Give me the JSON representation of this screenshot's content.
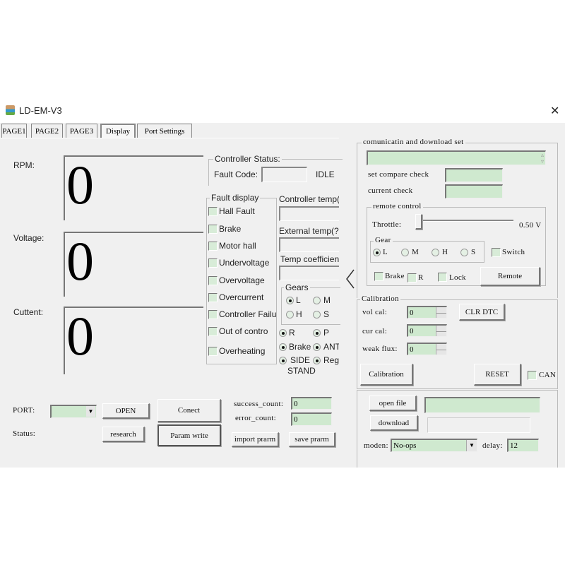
{
  "window": {
    "title": "LD-EM-V3",
    "close": "✕"
  },
  "tabs": [
    "PAGE1",
    "PAGE2",
    "PAGE3",
    "Display",
    "Port Settings"
  ],
  "display": {
    "rpm_label": "RPM:",
    "rpm": "0",
    "voltage_label": "Voltage:",
    "voltage": "0",
    "current_label": "Cuttent:",
    "current": "0"
  },
  "controller_status": {
    "title": "Controller Status:",
    "fault_code_label": "Fault Code:",
    "state": "IDLE"
  },
  "fault_display": {
    "title": "Fault display",
    "items": [
      "Hall Fault",
      "Brake",
      "Motor hall",
      "Undervoltage",
      "Overvoltage",
      "Overcurrent",
      "Controller Failure",
      "Out of contro",
      "Overheating"
    ]
  },
  "temps": {
    "controller": "Controller temp(?",
    "external": "External temp(?)",
    "coefficient": "Temp coefficient"
  },
  "gears": {
    "title": "Gears",
    "options": [
      "L",
      "M",
      "H",
      "S"
    ],
    "selected": "L"
  },
  "flags": [
    "R",
    "P",
    "Brake",
    "ANT",
    "SIDE STAND",
    "Rege"
  ],
  "bottom": {
    "port_label": "PORT:",
    "port_value": "",
    "open": "OPEN",
    "status_label": "Status:",
    "research": "research",
    "connect": "Conect",
    "param_write": "Param write",
    "success_label": "success_count:",
    "success": "0",
    "error_label": "error_count:",
    "error": "0",
    "import": "import prarm",
    "save": "save prarm"
  },
  "comm": {
    "title": "comunicatin and download set",
    "set_compare": "set compare check",
    "current_check": "current check"
  },
  "remote": {
    "title": "remote control",
    "throttle_label": "Throttle:",
    "throttle_value": "0.50 V",
    "throttle_fraction": 0.0,
    "gear_title": "Gear",
    "gears": [
      "L",
      "M",
      "H",
      "S"
    ],
    "gear_selected": "L",
    "switch": "Switch",
    "brake": "Brake",
    "r": "R",
    "lock": "Lock",
    "remote_button": "Remote"
  },
  "calibration": {
    "title": "Calibration",
    "vol_label": "vol cal:",
    "vol": "0",
    "cur_label": "cur cal:",
    "cur": "0",
    "weak_label": "weak flux:",
    "weak": "0",
    "clr_dtc": "CLR DTC",
    "calibrate": "Calibration",
    "reset": "RESET",
    "can": "CAN"
  },
  "download": {
    "open_file": "open file",
    "download": "download",
    "moden_label": "moden:",
    "moden": "No-ops",
    "delay_label": "delay:",
    "delay": "12"
  },
  "colors": {
    "field": "#cfe9cf",
    "background": "#f0f0f0"
  }
}
